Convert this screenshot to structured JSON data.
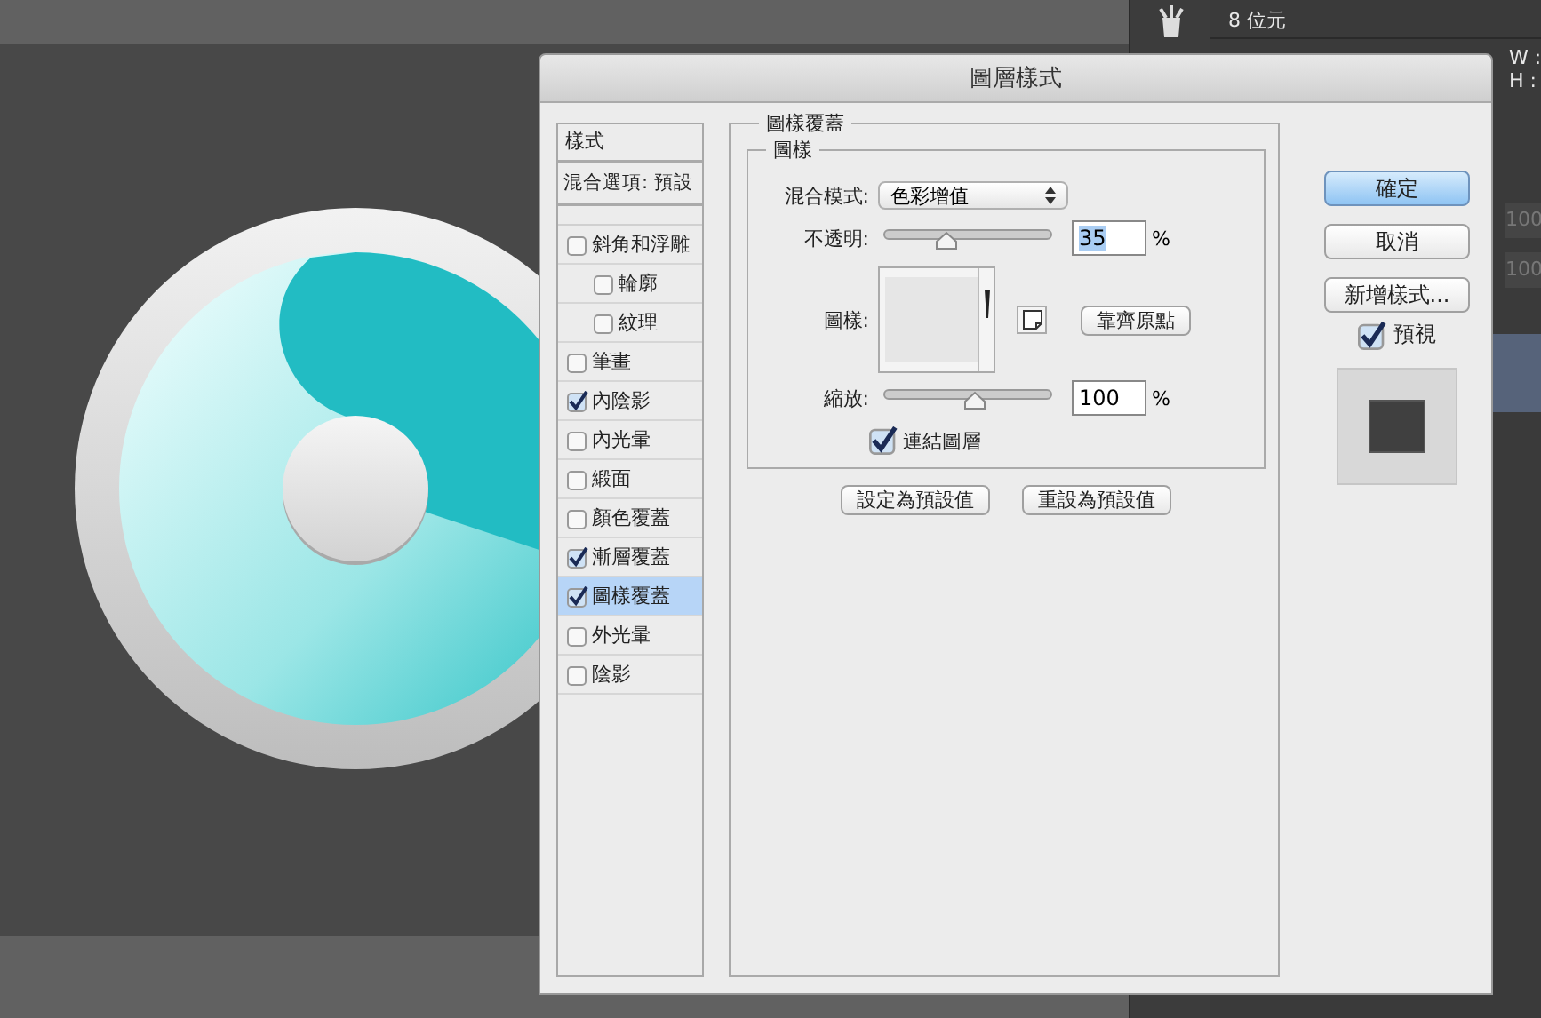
{
  "panel": {
    "bit_depth": "8 位元",
    "w_label": "W :",
    "h_label": "H :",
    "values": [
      "100",
      "100"
    ]
  },
  "window": {
    "title": "圖層樣式"
  },
  "styles_list": {
    "header": "樣式",
    "blending_options": "混合選項: 預設",
    "items": [
      {
        "label": "斜角和浮雕",
        "checked": false,
        "selected": false,
        "children": [
          {
            "label": "輪廓",
            "checked": false,
            "selected": false
          },
          {
            "label": "紋理",
            "checked": false,
            "selected": false
          }
        ]
      },
      {
        "label": "筆畫",
        "checked": false,
        "selected": false
      },
      {
        "label": "內陰影",
        "checked": true,
        "selected": false
      },
      {
        "label": "內光暈",
        "checked": false,
        "selected": false
      },
      {
        "label": "緞面",
        "checked": false,
        "selected": false
      },
      {
        "label": "顏色覆蓋",
        "checked": false,
        "selected": false
      },
      {
        "label": "漸層覆蓋",
        "checked": true,
        "selected": false
      },
      {
        "label": "圖樣覆蓋",
        "checked": true,
        "selected": true
      },
      {
        "label": "外光暈",
        "checked": false,
        "selected": false
      },
      {
        "label": "陰影",
        "checked": false,
        "selected": false
      }
    ]
  },
  "pattern_overlay": {
    "title": "圖樣覆蓋",
    "pattern_group": {
      "title": "圖樣",
      "blend_mode_label": "混合模式:",
      "blend_mode": "色彩增值",
      "opacity_label": "不透明:",
      "opacity": {
        "level": 0.35,
        "value": "35",
        "text_selected": true,
        "unit": "%"
      },
      "pattern_label": "圖樣:",
      "snap_button": "靠齊原點",
      "scale_label": "縮放:",
      "scale": {
        "level": 0.5,
        "value": "100",
        "text_selected": false,
        "unit": "%"
      },
      "link_layer": {
        "label": "連結圖層",
        "checked": true
      }
    },
    "buttons": [
      "設定為預設值",
      "重設為預設值"
    ]
  },
  "dialog_buttons": [
    {
      "label": "確定",
      "kind": "default"
    },
    {
      "label": "取消",
      "kind": "normal"
    },
    {
      "label": "新增樣式...",
      "kind": "normal"
    }
  ],
  "preview": {
    "label": "預視",
    "checked": true
  }
}
